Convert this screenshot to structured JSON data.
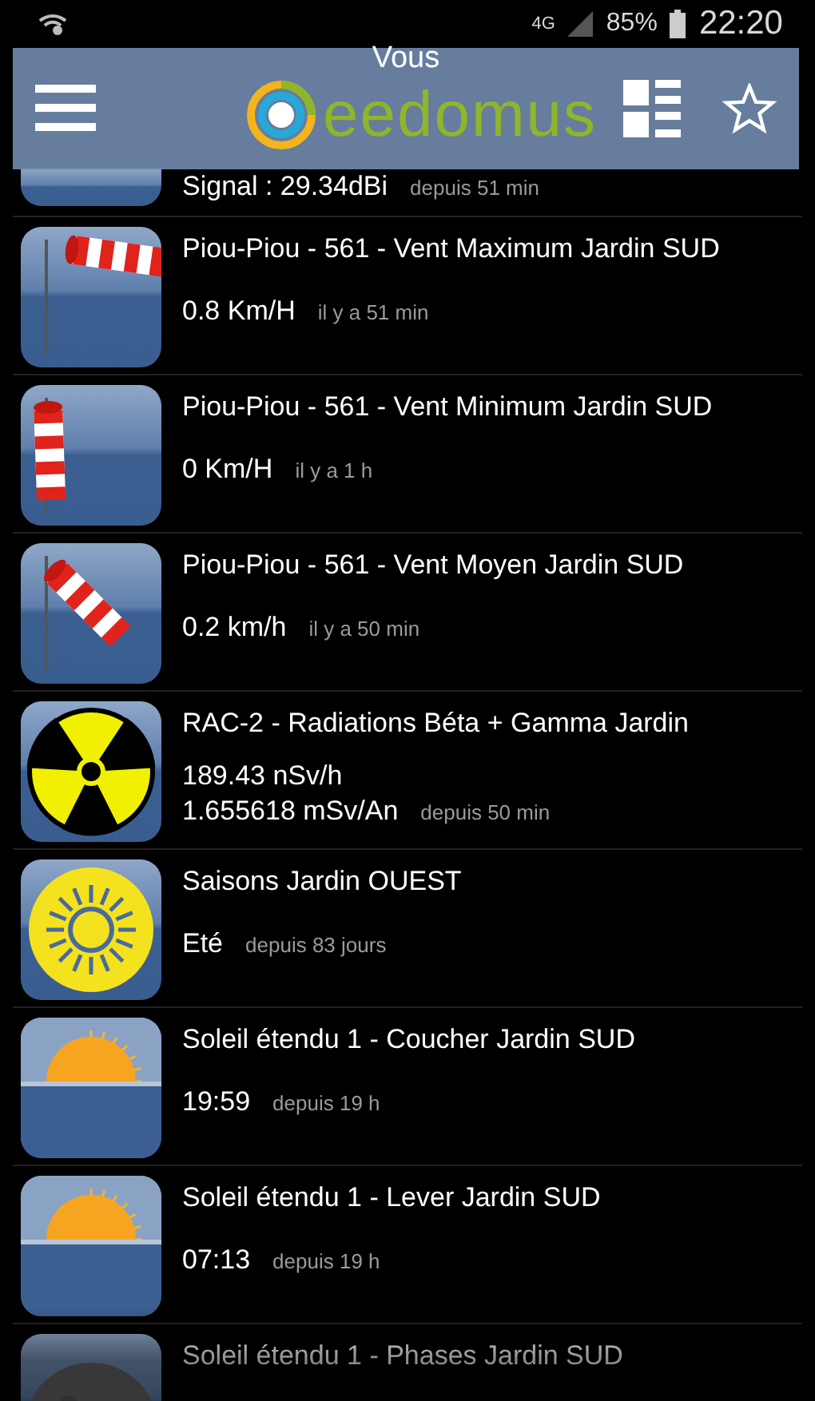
{
  "status_bar": {
    "network": "4G",
    "battery": "85%",
    "time": "22:20"
  },
  "header": {
    "title": "Vous",
    "logo_text": "eedomus"
  },
  "devices": [
    {
      "kind": "signal",
      "values": [
        "Signal : 29.34dBi"
      ],
      "time": "depuis 51 min"
    },
    {
      "kind": "gale",
      "title": "Piou-Piou - 561 - Vent Maximum Jardin SUD",
      "values": [
        "0.8 Km/H"
      ],
      "time": "il y a 51 min"
    },
    {
      "kind": "calm",
      "title": "Piou-Piou - 561 - Vent Minimum Jardin SUD",
      "values": [
        "0 Km/H"
      ],
      "time": "il y a 1 h"
    },
    {
      "kind": "breeze",
      "title": "Piou-Piou - 561 - Vent Moyen Jardin SUD",
      "values": [
        "0.2 km/h"
      ],
      "time": "il y a 50 min"
    },
    {
      "kind": "radiation",
      "title": "RAC-2 - Radiations Béta + Gamma Jardin",
      "values": [
        "189.43 nSv/h",
        "1.655618 mSv/An"
      ],
      "time": "depuis 50 min"
    },
    {
      "kind": "season",
      "title": "Saisons Jardin OUEST",
      "values": [
        "Eté"
      ],
      "time": "depuis 83 jours"
    },
    {
      "kind": "horizon",
      "title": "Soleil étendu 1 - Coucher Jardin SUD",
      "values": [
        "19:59"
      ],
      "time": "depuis 19 h"
    },
    {
      "kind": "horizon",
      "title": "Soleil étendu 1 - Lever Jardin SUD",
      "values": [
        "07:13"
      ],
      "time": "depuis 19 h"
    },
    {
      "kind": "moon",
      "title": "Soleil étendu 1 - Phases Jardin SUD"
    }
  ]
}
